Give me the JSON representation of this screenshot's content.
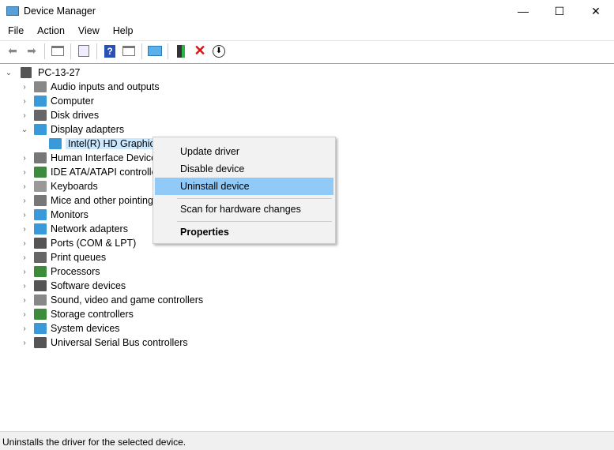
{
  "window": {
    "title": "Device Manager",
    "minimize": "—",
    "maximize": "☐",
    "close": "✕"
  },
  "menu": [
    "File",
    "Action",
    "View",
    "Help"
  ],
  "toolbar": [
    "back-arrow-icon",
    "forward-arrow-icon",
    "show-hide-console-tree-icon",
    "properties-icon",
    "help-icon",
    "action-pane-icon",
    "scan-hardware-icon",
    "update-driver-icon",
    "uninstall-icon",
    "disable-device-icon"
  ],
  "tree": {
    "root": "PC-13-27",
    "items": [
      {
        "label": "Audio inputs and outputs",
        "icon": "speaker-icon",
        "color": "#888888"
      },
      {
        "label": "Computer",
        "icon": "monitor-icon",
        "color": "#3a9ad9"
      },
      {
        "label": "Disk drives",
        "icon": "disk-icon",
        "color": "#666666"
      },
      {
        "label": "Display adapters",
        "icon": "display-adapter-icon",
        "color": "#3a9ad9",
        "expanded": true,
        "children": [
          {
            "label": "Intel(R) HD Graphics",
            "selected": true
          }
        ]
      },
      {
        "label": "Human Interface Devices",
        "icon": "hid-icon",
        "color": "#777777"
      },
      {
        "label": "IDE ATA/ATAPI controllers",
        "icon": "ide-controller-icon",
        "color": "#3c8c3c"
      },
      {
        "label": "Keyboards",
        "icon": "keyboard-icon",
        "color": "#999999"
      },
      {
        "label": "Mice and other pointing devices",
        "icon": "mouse-icon",
        "color": "#777777"
      },
      {
        "label": "Monitors",
        "icon": "monitor-icon",
        "color": "#3a9ad9"
      },
      {
        "label": "Network adapters",
        "icon": "network-icon",
        "color": "#3a9ad9"
      },
      {
        "label": "Ports (COM & LPT)",
        "icon": "port-icon",
        "color": "#555555"
      },
      {
        "label": "Print queues",
        "icon": "printer-icon",
        "color": "#666666"
      },
      {
        "label": "Processors",
        "icon": "processor-icon",
        "color": "#3c8c3c"
      },
      {
        "label": "Software devices",
        "icon": "software-device-icon",
        "color": "#555555"
      },
      {
        "label": "Sound, video and game controllers",
        "icon": "sound-icon",
        "color": "#888888"
      },
      {
        "label": "Storage controllers",
        "icon": "storage-icon",
        "color": "#3c8c3c"
      },
      {
        "label": "System devices",
        "icon": "system-icon",
        "color": "#3a9ad9"
      },
      {
        "label": "Universal Serial Bus controllers",
        "icon": "usb-icon",
        "color": "#555555"
      }
    ]
  },
  "context_menu": {
    "items": [
      "Update driver",
      "Disable device",
      "Uninstall device",
      "Scan for hardware changes",
      "Properties"
    ],
    "highlighted": "Uninstall device",
    "highlight_color": "#91c9f7"
  },
  "status": "Uninstalls the driver for the selected device."
}
